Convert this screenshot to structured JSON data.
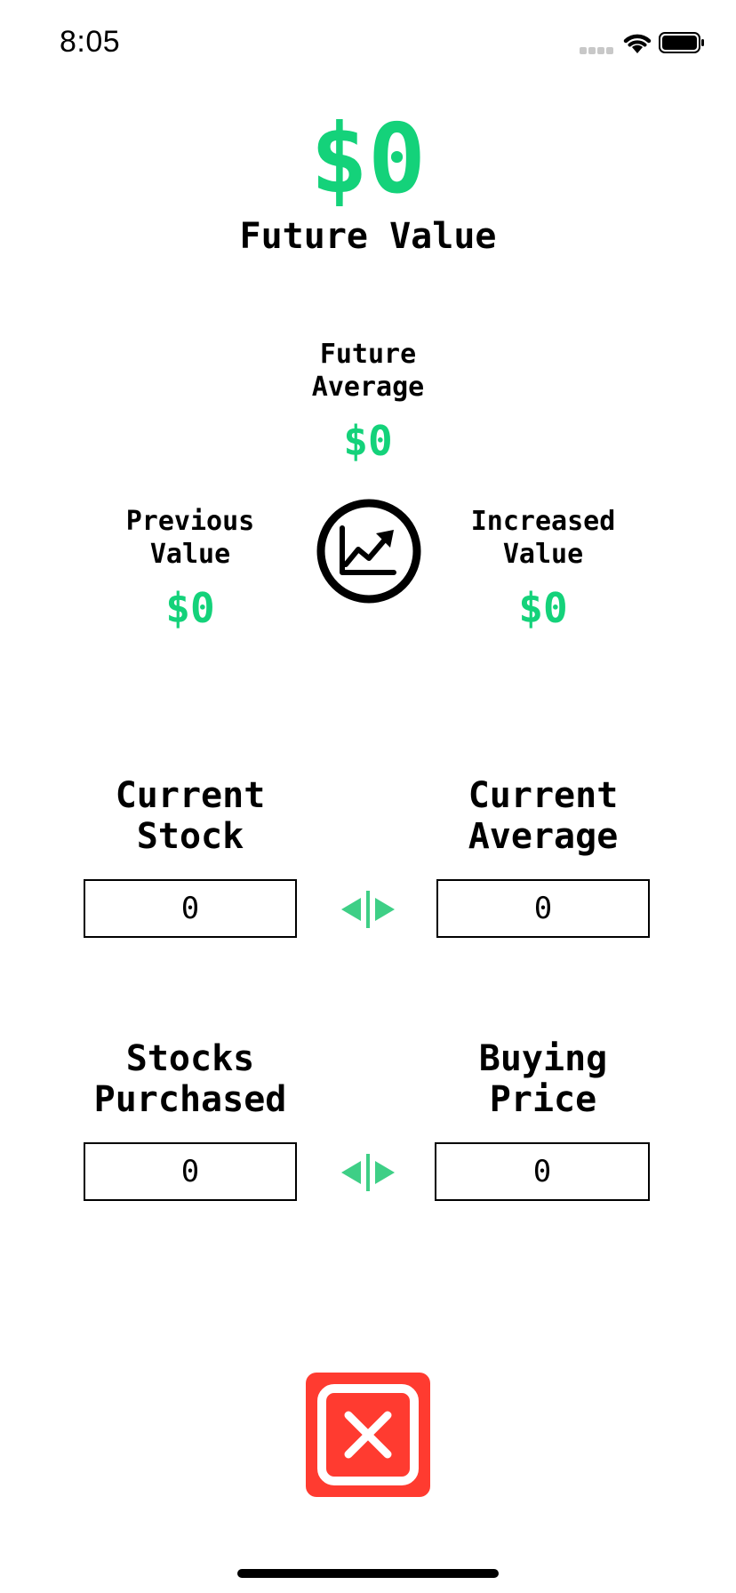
{
  "status_bar": {
    "time": "8:05"
  },
  "summary": {
    "future_value": "$0",
    "future_value_label": "Future Value"
  },
  "stats": {
    "future_average_label": "Future\nAverage",
    "future_average_value": "$0",
    "previous_value_label": "Previous\nValue",
    "previous_value_value": "$0",
    "increased_value_label": "Increased\nValue",
    "increased_value_value": "$0"
  },
  "inputs": {
    "current_stock_label": "Current\nStock",
    "current_stock_value": "0",
    "current_average_label": "Current\nAverage",
    "current_average_value": "0",
    "stocks_purchased_label": "Stocks\nPurchased",
    "stocks_purchased_value": "0",
    "buying_price_label": "Buying\nPrice",
    "buying_price_value": "0"
  },
  "icons": {
    "chart": "chart-line-uptrend-icon",
    "swap": "swap-horizontal-icon",
    "close": "close-icon"
  },
  "colors": {
    "accent_green": "#14d27a",
    "swap_green": "#3ecf86",
    "close_red": "#ff3b30"
  }
}
